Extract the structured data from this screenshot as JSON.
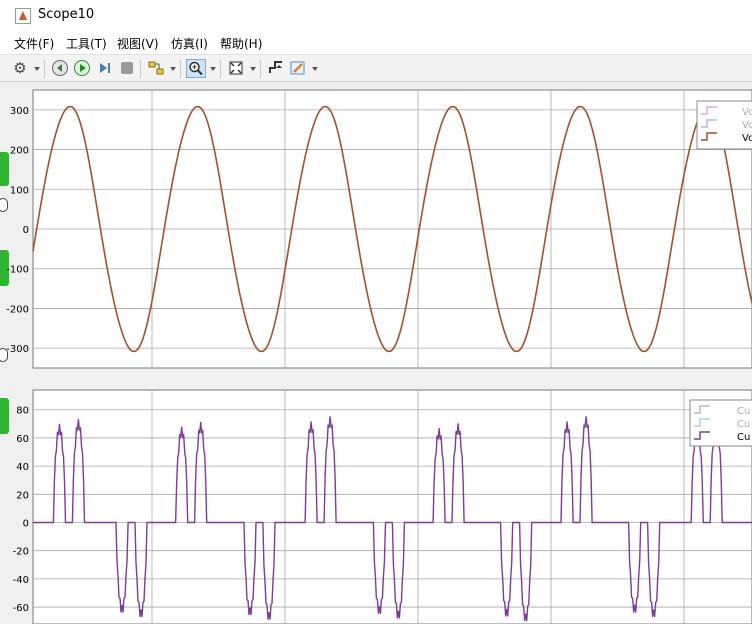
{
  "window": {
    "title": "Scope10",
    "icon": "matlab-logo-icon"
  },
  "menu": {
    "items": [
      "文件(F)",
      "工具(T)",
      "视图(V)",
      "仿真(I)",
      "帮助(H)"
    ]
  },
  "toolbar": {
    "icons": [
      "gear-icon",
      "step-back-icon",
      "run-icon",
      "step-forward-icon",
      "stop-icon",
      "highlight-block-icon",
      "zoom-in-icon",
      "fit-to-view-icon",
      "triggers-icon",
      "style-icon"
    ]
  },
  "colors": {
    "voltage_trace": "#a0522d",
    "current_trace": "#7d3c98",
    "grid": "#a8a8a8",
    "plot_bg": "#ffffff"
  },
  "chart_data": [
    {
      "type": "line",
      "title": "",
      "xlabel": "",
      "ylabel": "",
      "yticks": [
        300,
        200,
        100,
        0,
        -100,
        -200,
        -300
      ],
      "ylim": [
        -400,
        400
      ],
      "grid": true,
      "legend_position": "top-right",
      "legend": [
        "Vo",
        "Vo",
        "Vo"
      ],
      "series": [
        {
          "name": "Vo",
          "waveform": "sine",
          "amplitude": 308,
          "cycles_visible": 5.5,
          "peaks_at_x_fraction": [
            0.05,
            0.22,
            0.4,
            0.578,
            0.756,
            0.937
          ],
          "troughs_at_x_fraction": [
            0.137,
            0.315,
            0.495,
            0.672,
            0.85
          ]
        }
      ]
    },
    {
      "type": "line",
      "title": "",
      "xlabel": "",
      "ylabel": "",
      "yticks": [
        80,
        60,
        40,
        20,
        0,
        -20,
        -40,
        -60
      ],
      "ylim": [
        -72,
        95
      ],
      "grid": true,
      "legend_position": "top-right",
      "legend": [
        "Cu",
        "Cu",
        "Cu"
      ],
      "series": [
        {
          "name": "Cu",
          "waveform": "double-hump pulses",
          "positive_peak_values": [
            70,
            68,
            72,
            67,
            72,
            70,
            73,
            68,
            73,
            68
          ],
          "negative_peak_values": [
            -65,
            -67,
            -66,
            -68,
            -65,
            -67,
            -66,
            -67,
            -66,
            -67
          ],
          "baseline": 0
        }
      ]
    }
  ]
}
